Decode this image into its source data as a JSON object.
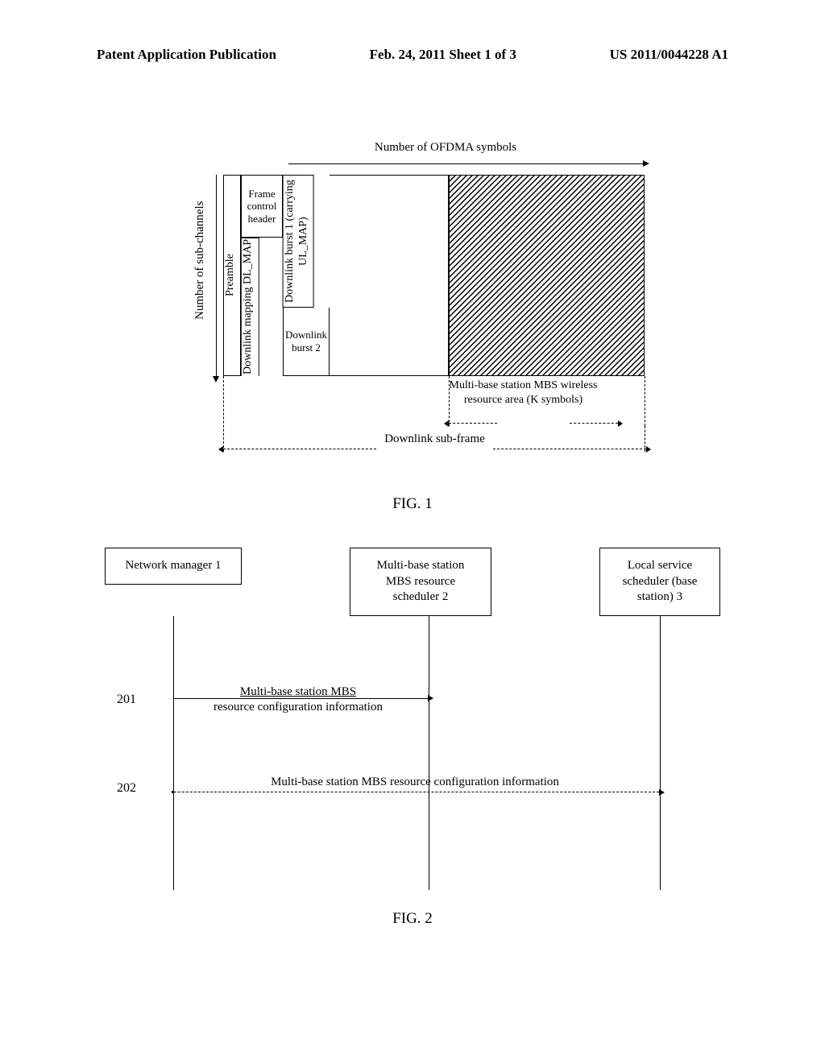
{
  "header": {
    "left": "Patent Application Publication",
    "center": "Feb. 24, 2011  Sheet 1 of 3",
    "right": "US 2011/0044228 A1"
  },
  "fig1": {
    "x_axis": "Number of OFDMA symbols",
    "y_axis": "Number of sub-channels",
    "preamble": "Preamble",
    "fch": "Frame control header",
    "dlmap": "Downlink mapping DL_MAP",
    "db1": "Downlink burst 1 (carrying UL_MAP)",
    "db2": "Downlink burst 2",
    "mbs_label": "Multi-base station MBS wireless resource area (K symbols)",
    "subframe": "Downlink sub-frame",
    "caption": "FIG. 1"
  },
  "fig2": {
    "box1": "Network manager 1",
    "box2": "Multi-base station MBS resource scheduler 2",
    "box3": "Local service scheduler (base station) 3",
    "step201": "201",
    "step202": "202",
    "msg1_line1": "Multi-base station MBS",
    "msg1_line2": "resource configuration information",
    "msg2": "Multi-base station MBS resource configuration information",
    "caption": "FIG. 2"
  }
}
